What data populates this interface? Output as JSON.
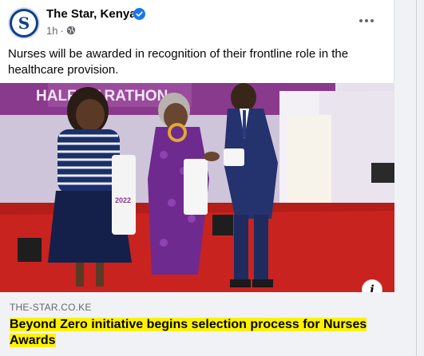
{
  "post": {
    "page_name": "The Star, Kenya",
    "avatar_letter": "S",
    "timestamp": "1h",
    "separator": "·",
    "body_text": "Nurses will be awarded in recognition of their frontline role in the healthcare provision.",
    "image_banner_text": "HALF MARATHON",
    "image_tag_text": "2022"
  },
  "link_preview": {
    "domain": "THE-STAR.CO.KE",
    "title": "Beyond Zero initiative begins selection process for Nurses Awards"
  },
  "icons": {
    "verified": "verified-badge-icon",
    "audience": "globe-icon",
    "more": "more-options-icon",
    "info": "info-icon"
  },
  "colors": {
    "brand": "#0d3f8a",
    "verified": "#1877f2",
    "highlight": "#fff200",
    "carpet": "#c8231f"
  }
}
